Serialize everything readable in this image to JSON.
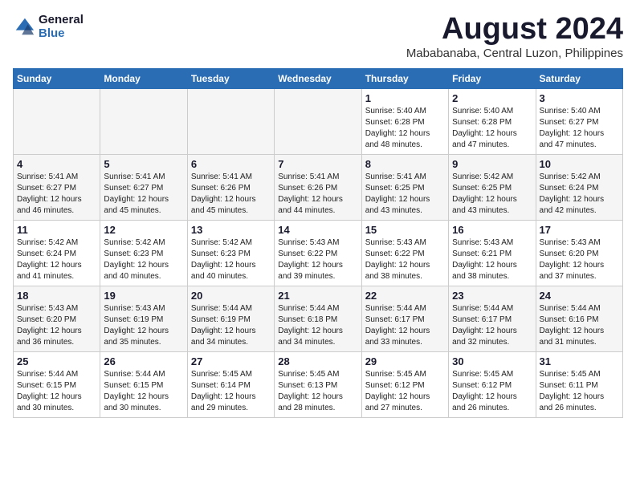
{
  "logo": {
    "line1": "General",
    "line2": "Blue"
  },
  "title": {
    "month_year": "August 2024",
    "location": "Mababanaba, Central Luzon, Philippines"
  },
  "weekdays": [
    "Sunday",
    "Monday",
    "Tuesday",
    "Wednesday",
    "Thursday",
    "Friday",
    "Saturday"
  ],
  "weeks": [
    [
      {
        "day": "",
        "info": ""
      },
      {
        "day": "",
        "info": ""
      },
      {
        "day": "",
        "info": ""
      },
      {
        "day": "",
        "info": ""
      },
      {
        "day": "1",
        "info": "Sunrise: 5:40 AM\nSunset: 6:28 PM\nDaylight: 12 hours\nand 48 minutes."
      },
      {
        "day": "2",
        "info": "Sunrise: 5:40 AM\nSunset: 6:28 PM\nDaylight: 12 hours\nand 47 minutes."
      },
      {
        "day": "3",
        "info": "Sunrise: 5:40 AM\nSunset: 6:27 PM\nDaylight: 12 hours\nand 47 minutes."
      }
    ],
    [
      {
        "day": "4",
        "info": "Sunrise: 5:41 AM\nSunset: 6:27 PM\nDaylight: 12 hours\nand 46 minutes."
      },
      {
        "day": "5",
        "info": "Sunrise: 5:41 AM\nSunset: 6:27 PM\nDaylight: 12 hours\nand 45 minutes."
      },
      {
        "day": "6",
        "info": "Sunrise: 5:41 AM\nSunset: 6:26 PM\nDaylight: 12 hours\nand 45 minutes."
      },
      {
        "day": "7",
        "info": "Sunrise: 5:41 AM\nSunset: 6:26 PM\nDaylight: 12 hours\nand 44 minutes."
      },
      {
        "day": "8",
        "info": "Sunrise: 5:41 AM\nSunset: 6:25 PM\nDaylight: 12 hours\nand 43 minutes."
      },
      {
        "day": "9",
        "info": "Sunrise: 5:42 AM\nSunset: 6:25 PM\nDaylight: 12 hours\nand 43 minutes."
      },
      {
        "day": "10",
        "info": "Sunrise: 5:42 AM\nSunset: 6:24 PM\nDaylight: 12 hours\nand 42 minutes."
      }
    ],
    [
      {
        "day": "11",
        "info": "Sunrise: 5:42 AM\nSunset: 6:24 PM\nDaylight: 12 hours\nand 41 minutes."
      },
      {
        "day": "12",
        "info": "Sunrise: 5:42 AM\nSunset: 6:23 PM\nDaylight: 12 hours\nand 40 minutes."
      },
      {
        "day": "13",
        "info": "Sunrise: 5:42 AM\nSunset: 6:23 PM\nDaylight: 12 hours\nand 40 minutes."
      },
      {
        "day": "14",
        "info": "Sunrise: 5:43 AM\nSunset: 6:22 PM\nDaylight: 12 hours\nand 39 minutes."
      },
      {
        "day": "15",
        "info": "Sunrise: 5:43 AM\nSunset: 6:22 PM\nDaylight: 12 hours\nand 38 minutes."
      },
      {
        "day": "16",
        "info": "Sunrise: 5:43 AM\nSunset: 6:21 PM\nDaylight: 12 hours\nand 38 minutes."
      },
      {
        "day": "17",
        "info": "Sunrise: 5:43 AM\nSunset: 6:20 PM\nDaylight: 12 hours\nand 37 minutes."
      }
    ],
    [
      {
        "day": "18",
        "info": "Sunrise: 5:43 AM\nSunset: 6:20 PM\nDaylight: 12 hours\nand 36 minutes."
      },
      {
        "day": "19",
        "info": "Sunrise: 5:43 AM\nSunset: 6:19 PM\nDaylight: 12 hours\nand 35 minutes."
      },
      {
        "day": "20",
        "info": "Sunrise: 5:44 AM\nSunset: 6:19 PM\nDaylight: 12 hours\nand 34 minutes."
      },
      {
        "day": "21",
        "info": "Sunrise: 5:44 AM\nSunset: 6:18 PM\nDaylight: 12 hours\nand 34 minutes."
      },
      {
        "day": "22",
        "info": "Sunrise: 5:44 AM\nSunset: 6:17 PM\nDaylight: 12 hours\nand 33 minutes."
      },
      {
        "day": "23",
        "info": "Sunrise: 5:44 AM\nSunset: 6:17 PM\nDaylight: 12 hours\nand 32 minutes."
      },
      {
        "day": "24",
        "info": "Sunrise: 5:44 AM\nSunset: 6:16 PM\nDaylight: 12 hours\nand 31 minutes."
      }
    ],
    [
      {
        "day": "25",
        "info": "Sunrise: 5:44 AM\nSunset: 6:15 PM\nDaylight: 12 hours\nand 30 minutes."
      },
      {
        "day": "26",
        "info": "Sunrise: 5:44 AM\nSunset: 6:15 PM\nDaylight: 12 hours\nand 30 minutes."
      },
      {
        "day": "27",
        "info": "Sunrise: 5:45 AM\nSunset: 6:14 PM\nDaylight: 12 hours\nand 29 minutes."
      },
      {
        "day": "28",
        "info": "Sunrise: 5:45 AM\nSunset: 6:13 PM\nDaylight: 12 hours\nand 28 minutes."
      },
      {
        "day": "29",
        "info": "Sunrise: 5:45 AM\nSunset: 6:12 PM\nDaylight: 12 hours\nand 27 minutes."
      },
      {
        "day": "30",
        "info": "Sunrise: 5:45 AM\nSunset: 6:12 PM\nDaylight: 12 hours\nand 26 minutes."
      },
      {
        "day": "31",
        "info": "Sunrise: 5:45 AM\nSunset: 6:11 PM\nDaylight: 12 hours\nand 26 minutes."
      }
    ]
  ]
}
